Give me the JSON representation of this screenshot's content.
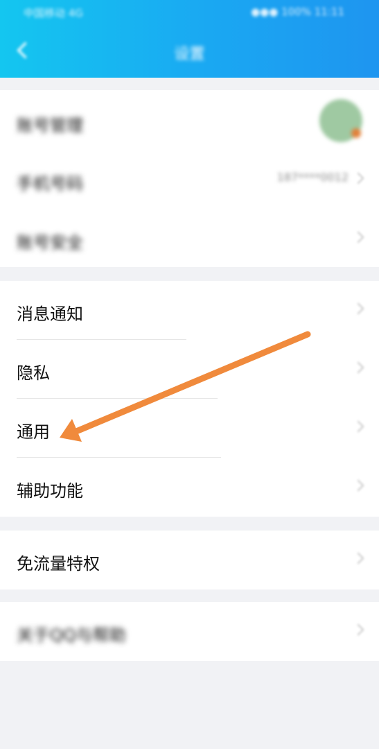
{
  "status_bar": {
    "left": "中国移动 4G",
    "right": "●●● 100% 11:11"
  },
  "header": {
    "title": "设置"
  },
  "account_group": {
    "rows": [
      {
        "label": "账号管理"
      },
      {
        "label": "手机号码",
        "value": "187****0012"
      },
      {
        "label": "账号安全"
      }
    ]
  },
  "settings_group": {
    "rows": [
      {
        "label": "消息通知"
      },
      {
        "label": "隐私"
      },
      {
        "label": "通用"
      },
      {
        "label": "辅助功能"
      }
    ]
  },
  "traffic_group": {
    "rows": [
      {
        "label": "免流量特权"
      }
    ]
  },
  "about_group": {
    "rows": [
      {
        "label": "关于QQ与帮助"
      }
    ]
  },
  "annotation": {
    "arrow_color": "#f08a3c"
  }
}
